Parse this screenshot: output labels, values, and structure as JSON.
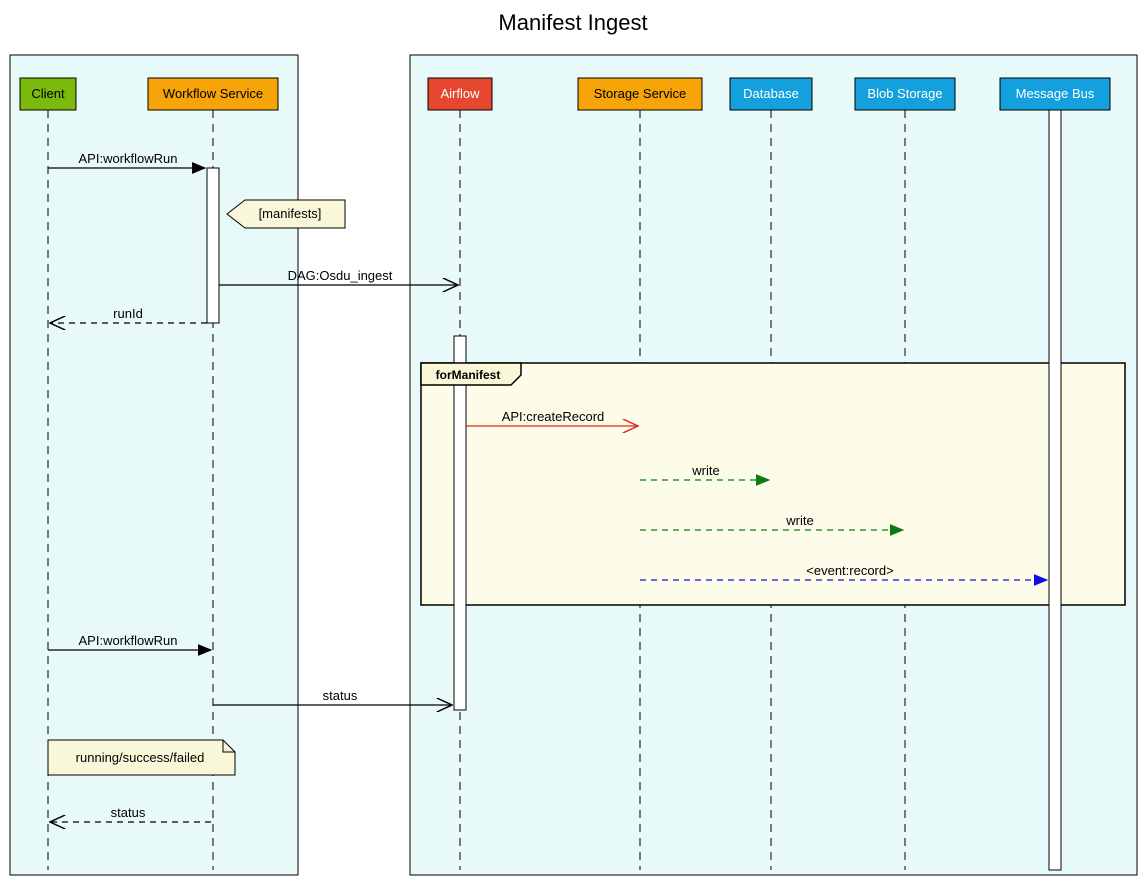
{
  "diagram": {
    "title": "Manifest Ingest",
    "actors": {
      "client": {
        "label": "Client",
        "fill": "#7cb90d"
      },
      "workflow": {
        "label": "Workflow Service",
        "fill": "#f7a409"
      },
      "airflow": {
        "label": "Airflow",
        "fill": "#e5472f"
      },
      "storage": {
        "label": "Storage Service",
        "fill": "#f7a409"
      },
      "database": {
        "label": "Database",
        "fill": "#14a0dd"
      },
      "blob": {
        "label": "Blob Storage",
        "fill": "#14a0dd"
      },
      "mbus": {
        "label": "Message Bus",
        "fill": "#14a0dd"
      }
    },
    "messages": {
      "m1": "API:workflowRun",
      "m2": "DAG:Osdu_ingest",
      "m3": "runId",
      "m4": "API:createRecord",
      "m5": "write",
      "m6": "write",
      "m7": "<event:record>",
      "m8": "API:workflowRun",
      "m9": "status",
      "m10": "status"
    },
    "notes": {
      "manifests": "[manifests]",
      "statuses": "running/success/failed"
    },
    "loop": {
      "label": "forManifest"
    }
  },
  "chart_data": {
    "type": "sequence-diagram",
    "title": "Manifest Ingest",
    "participants": [
      {
        "id": "client",
        "name": "Client",
        "group": "left"
      },
      {
        "id": "workflow",
        "name": "Workflow Service",
        "group": "left"
      },
      {
        "id": "airflow",
        "name": "Airflow",
        "group": "right"
      },
      {
        "id": "storage",
        "name": "Storage Service",
        "group": "right"
      },
      {
        "id": "database",
        "name": "Database",
        "group": "right"
      },
      {
        "id": "blob",
        "name": "Blob Storage",
        "group": "right"
      },
      {
        "id": "mbus",
        "name": "Message Bus",
        "group": "right"
      }
    ],
    "interactions": [
      {
        "from": "client",
        "to": "workflow",
        "label": "API:workflowRun",
        "style": "solid"
      },
      {
        "note_on": "workflow",
        "text": "[manifests]"
      },
      {
        "from": "workflow",
        "to": "airflow",
        "label": "DAG:Osdu_ingest",
        "style": "solid-open"
      },
      {
        "from": "workflow",
        "to": "client",
        "label": "runId",
        "style": "dashed-open"
      },
      {
        "loop": "forManifest",
        "body": [
          {
            "from": "airflow",
            "to": "storage",
            "label": "API:createRecord",
            "style": "solid-open",
            "color": "red"
          },
          {
            "from": "storage",
            "to": "database",
            "label": "write",
            "style": "dashed",
            "color": "green"
          },
          {
            "from": "storage",
            "to": "blob",
            "label": "write",
            "style": "dashed",
            "color": "green"
          },
          {
            "from": "storage",
            "to": "mbus",
            "label": "<event:record>",
            "style": "dashed",
            "color": "blue"
          }
        ]
      },
      {
        "from": "client",
        "to": "workflow",
        "label": "API:workflowRun",
        "style": "solid"
      },
      {
        "from": "workflow",
        "to": "airflow",
        "label": "status",
        "style": "solid-open"
      },
      {
        "note_on": "client-workflow",
        "text": "running/success/failed"
      },
      {
        "from": "workflow",
        "to": "client",
        "label": "status",
        "style": "dashed-open"
      }
    ]
  }
}
